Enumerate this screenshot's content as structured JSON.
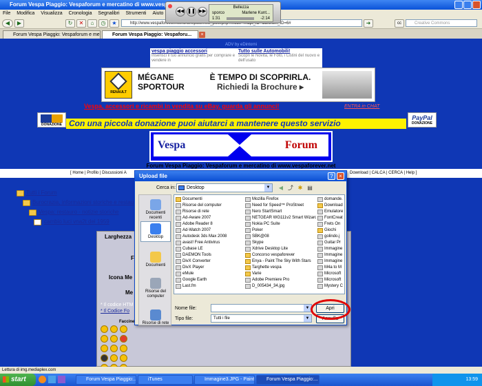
{
  "window": {
    "title": "Forum Vespa Piaggio: Vespaforum e mercatino di www.vespaforever.net"
  },
  "menu": [
    "File",
    "Modifica",
    "Visualizza",
    "Cronologia",
    "Segnalibri",
    "Strumenti",
    "Aiuto"
  ],
  "url": "http://www.vespaforever.net/forum/post...ew_post.php?mode=...&pt_ID=1&forum_ID=6#",
  "search_placeholder": "Creative Commons",
  "tabs": [
    {
      "label": "Forum Vespa Piaggio: Vespaforum e me...",
      "active": false
    },
    {
      "label": "Forum Vespa Piaggio: Vespaforu...",
      "active": true
    }
  ],
  "adv": {
    "label": "ADV by eDintorni",
    "ad1_title": "vespa piaggio accessori",
    "ad1_text": "Inserisci il tuo annuncio gratis per comprare e vendere in",
    "ad2_title": "Tutto sulle Automobili!",
    "ad2_text": "Scopri le Novità, le Foto, i Listini del nuovo e dell'usato"
  },
  "banner": {
    "line1": "MÉGANE",
    "line2": "SPORTOUR",
    "brand": "RENAULT",
    "tempo1": "È TEMPO DI SCOPRIRLA.",
    "tempo2": "Richiedi la Brochure ▸"
  },
  "promo": "Vespa, accessori e ricambi in vendita su eBay, guarda gli annunci!",
  "chat": "ENTRA in CHAT",
  "donation": "Con una piccola donazione puoi aiutarci a mantenere questo servizio",
  "visa_label": "DONAZIONE",
  "paypal_label": "PayPal",
  "paypal_sub": "DONAZIONE",
  "vespa_label": "Vespa",
  "forum_label": "Forum",
  "forum_title": "Forum Vespa Piaggio: Vespaforum e mercatino di www.vespaforever.net",
  "links_left": "[ Home | Profilo | Discussioni A",
  "links_right": "Download | CALCA | CERCA | Help ]",
  "tree": [
    "Tutti i Forum",
    "Burocrazia, informazioni storiche e restau",
    "Vespa: restauro - notizie storiche",
    "cambio luci vna2t del 1959"
  ],
  "form_labels": {
    "larghezza": "Larghezza",
    "f": "F",
    "icona": "Icona Me",
    "me": "Me",
    "codice1": "* Il codice HTM",
    "codice2": "* Il Codice Fo",
    "faccine": "Faccine"
  },
  "status": "Lettura di img.mediaplex.com",
  "taskbar": {
    "start": "start",
    "items": [
      {
        "label": "Forum Vespa Piaggio:...",
        "active": false
      },
      {
        "label": "iTunes",
        "active": false
      },
      {
        "label": "Immagine3.JPG - Paint",
        "active": false
      },
      {
        "label": "Forum Vespa Piaggio:...",
        "active": true
      }
    ],
    "clock": "13:59"
  },
  "itunes": {
    "song": "Bellezza",
    "artist": "Marlene Kunt...",
    "album": "sporco",
    "elapsed": "1:31",
    "remaining": "-2:14"
  },
  "dialog": {
    "title": "Upload file",
    "lookin_label": "Cerca in:",
    "lookin_value": "Desktop",
    "places": [
      "Documenti recenti",
      "Desktop",
      "Documenti",
      "Risorse del computer",
      "Risorse di rete"
    ],
    "files_col1": [
      "Documenti",
      "Risorse del computer",
      "Risorse di rete",
      "Ad-Aware 2007",
      "Adobe Reader 8",
      "Ad-Watch 2007",
      "Autodesk 3ds Max 2008",
      "avast! Free Antivirus",
      "Cubase LE",
      "DAEMON Tools",
      "DivX Converter",
      "DivX Player",
      "eMule",
      "Google Earth",
      "Last.fm"
    ],
    "files_col2": [
      "Mozilla Firefox",
      "Need for Speed™ ProStreet",
      "Nero StartSmart",
      "NETGEAR WG111v2 Smart Wizard",
      "Nokia PC Suite",
      "Poker",
      "SBK@08",
      "Skype",
      "Xdrive Desktop Lite",
      "Concorso vespaforever",
      "Enya - Paint The Sky With Stars",
      "Targhette vespa",
      "Varie",
      "Adobe Premiere Pro",
      "D_005434_34.jpg"
    ],
    "files_col3": [
      "domande.",
      "Download",
      "Emulatore",
      "FontCreat",
      "Frets On",
      "Giochi",
      "golindo.j",
      "Guitar Pr",
      "Immagine",
      "Immagine",
      "Immagine",
      "M4a to M",
      "Microsoft",
      "Microsoft",
      "Mystery C"
    ],
    "filename_label": "Nome file:",
    "filename_value": "",
    "filetype_label": "Tipo file:",
    "filetype_value": "Tutti i file",
    "open_button": "Apri",
    "cancel_button": "Annulla"
  },
  "colors": {
    "page_bg": "#0f37b5",
    "highlight": "#e00000",
    "donation_bg": "#fff200"
  }
}
